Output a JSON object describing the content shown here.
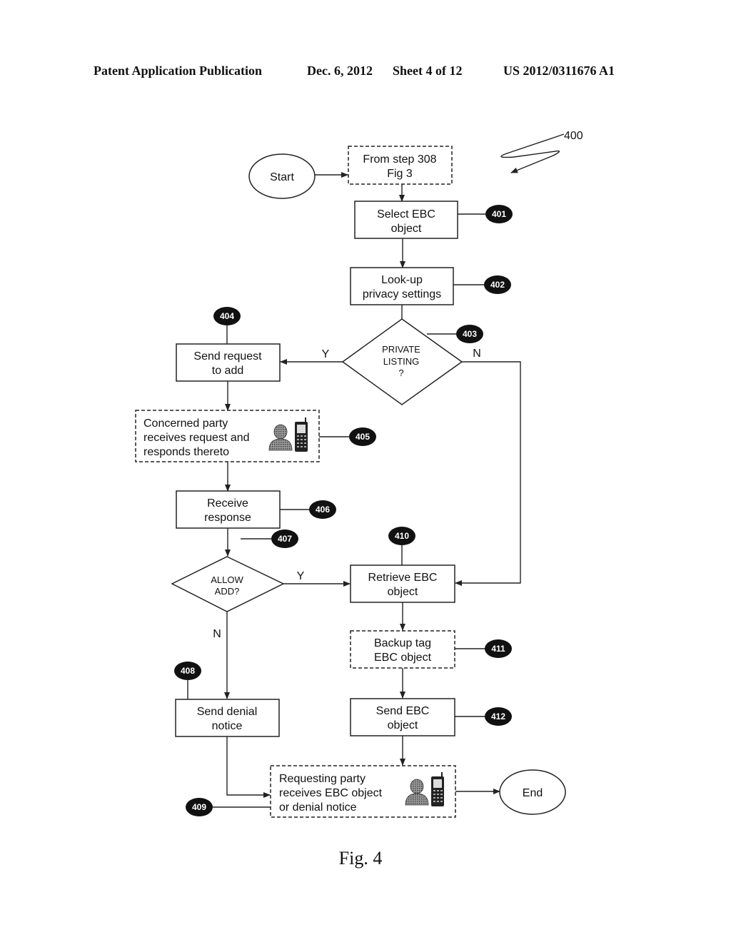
{
  "header": {
    "publication": "Patent Application Publication",
    "date": "Dec. 6, 2012",
    "sheet": "Sheet 4 of 12",
    "number": "US 2012/0311676 A1"
  },
  "figure": {
    "reference": "400",
    "caption": "Fig. 4"
  },
  "nodes": {
    "start": "Start",
    "end": "End",
    "from_step": [
      "From step 308",
      "Fig 3"
    ],
    "n401": [
      "Select EBC",
      "object"
    ],
    "n402": [
      "Look-up",
      "privacy settings"
    ],
    "n403": [
      "PRIVATE",
      "LISTING",
      "?"
    ],
    "n404": [
      "Send request",
      "to add"
    ],
    "n405": [
      "Concerned party",
      "receives request and",
      "responds thereto"
    ],
    "n406": [
      "Receive",
      "response"
    ],
    "n407": [
      "ALLOW",
      "ADD?"
    ],
    "n408": [
      "Send denial",
      "notice"
    ],
    "n409": [
      "Requesting party",
      "receives EBC object",
      "or denial notice"
    ],
    "n410": [
      "Retrieve EBC",
      "object"
    ],
    "n411": [
      "Backup tag",
      "EBC object"
    ],
    "n412": [
      "Send EBC",
      "object"
    ]
  },
  "badges": {
    "b401": "401",
    "b402": "402",
    "b403": "403",
    "b404": "404",
    "b405": "405",
    "b406": "406",
    "b407": "407",
    "b408": "408",
    "b409": "409",
    "b410": "410",
    "b411": "411",
    "b412": "412"
  },
  "edge_labels": {
    "private_yes": "Y",
    "private_no": "N",
    "allow_yes": "Y",
    "allow_no": "N"
  },
  "icons": {
    "person": "person-icon",
    "phone": "mobile-phone-icon"
  }
}
